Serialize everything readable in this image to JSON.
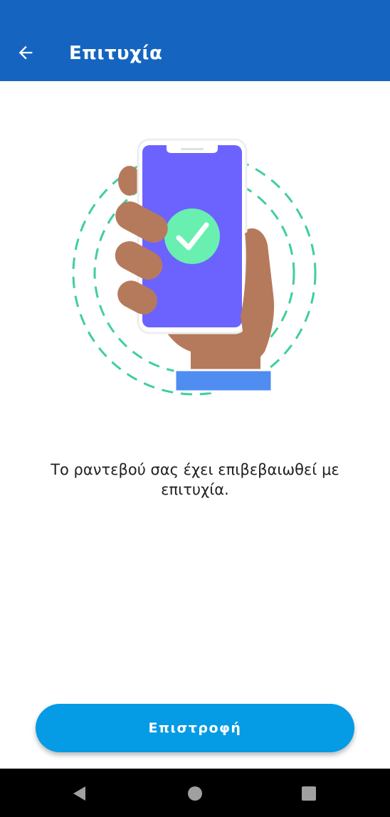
{
  "app_bar": {
    "title": "Επιτυχία",
    "back_icon": "arrow-left-icon",
    "background": "#1565c0"
  },
  "illustration": {
    "icons": [
      "hand-holding-phone-icon",
      "check-circle-icon"
    ],
    "colors": {
      "screen": "#6c63ff",
      "check": "#69efb0",
      "skin": "#b57a5c",
      "sleeve": "#4f8df0",
      "rings": "#3fcf9a"
    }
  },
  "main": {
    "message": "Το ραντεβού σας έχει επιβεβαιωθεί με επιτυχία."
  },
  "actions": {
    "return_label": "Επιστροφή",
    "color": "#069be5"
  },
  "system_nav": {
    "icons": [
      "back-triangle-icon",
      "home-circle-icon",
      "recents-square-icon"
    ]
  }
}
